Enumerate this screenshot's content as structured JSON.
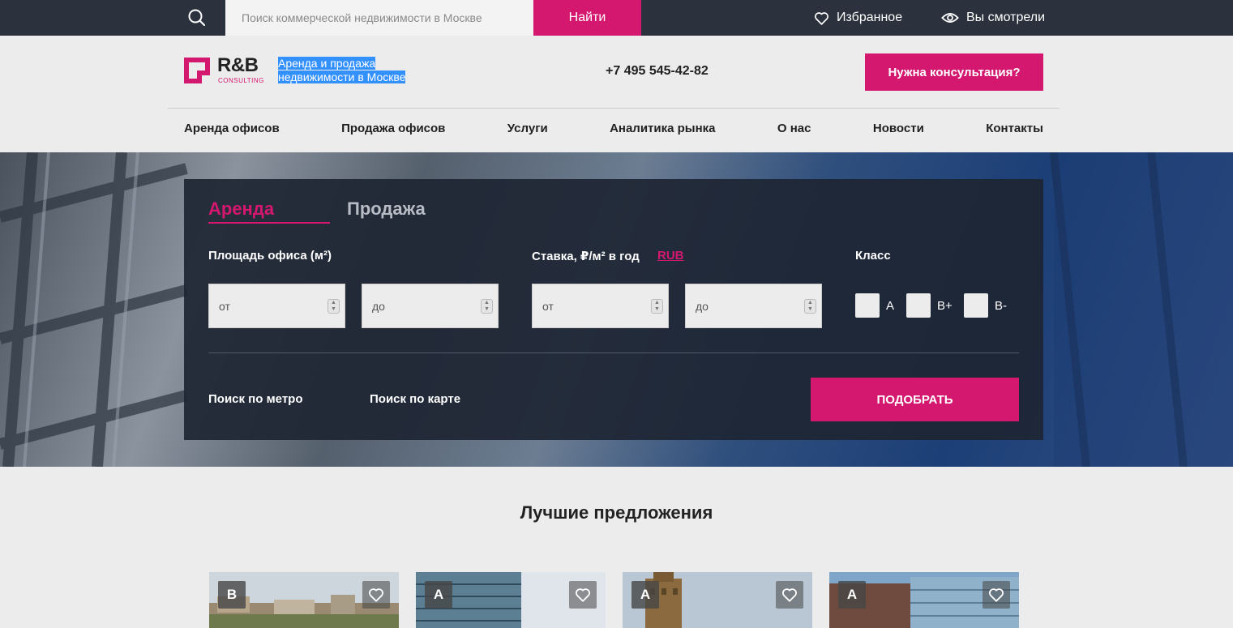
{
  "topbar": {
    "search_placeholder": "Поиск коммерческой недвижимости в Москве",
    "find_label": "Найти",
    "favorites_label": "Избранное",
    "viewed_label": "Вы смотрели"
  },
  "header": {
    "logo_text": "R&B",
    "logo_sub": "CONSULTING",
    "tagline_line1": "Аренда и продажа",
    "tagline_line2": "недвижимости в Москве",
    "phone": "+7 495 545-42-82",
    "consult_label": "Нужна консультация?"
  },
  "nav": {
    "items": [
      "Аренда офисов",
      "Продажа офисов",
      "Услуги",
      "Аналитика рынка",
      "О нас",
      "Новости",
      "Контакты"
    ]
  },
  "search_panel": {
    "tab_rent": "Аренда",
    "tab_sale": "Продажа",
    "area_label": "Площадь офиса (м²)",
    "rate_label": "Ставка, ₽/м² в год",
    "currency": "RUB",
    "class_label": "Класс",
    "from_placeholder": "от",
    "to_placeholder": "до",
    "classes": [
      "A",
      "B+",
      "B-"
    ],
    "metro_link": "Поиск по метро",
    "map_link": "Поиск по карте",
    "pick_label": "ПОДОБРАТЬ"
  },
  "offers": {
    "title": "Лучшие предложения",
    "cards": [
      {
        "class": "B"
      },
      {
        "class": "A"
      },
      {
        "class": "A"
      },
      {
        "class": "A"
      }
    ]
  },
  "colors": {
    "accent": "#d4176f",
    "topbar": "#2b323e",
    "panel": "#1e2634"
  }
}
